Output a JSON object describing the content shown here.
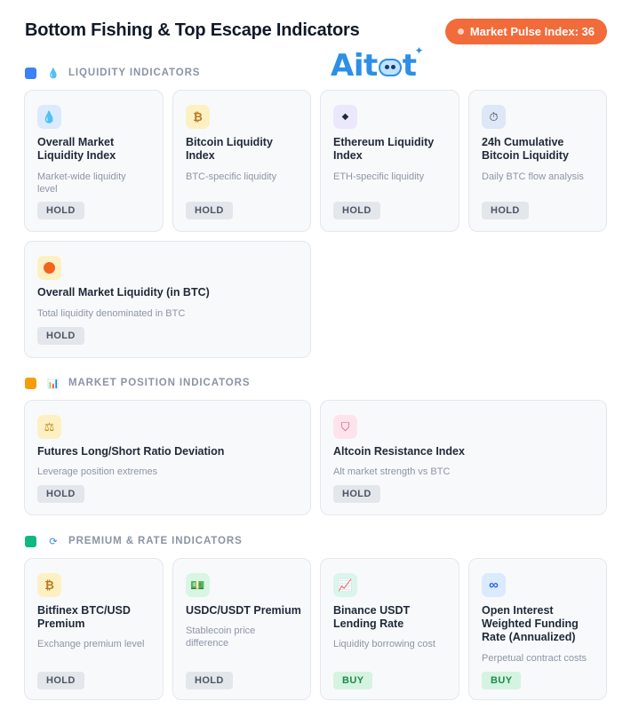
{
  "header": {
    "title": "Bottom Fishing & Top Escape Indicators",
    "pulse_label": "Market Pulse Index: 36"
  },
  "logo": {
    "text_left": "Ait",
    "text_right": "t"
  },
  "colors": {
    "accent_orange": "#f26b3a",
    "liquidity": "#3b82f6",
    "position": "#f59e0b",
    "premium": "#10b981",
    "hold_bg": "#e3e6eb",
    "buy_bg": "#d5f3e1"
  },
  "sections": [
    {
      "label": "LIQUIDITY INDICATORS",
      "icon": "droplet-icon",
      "cards": [
        {
          "title_1": "Overall Market",
          "title_2": "Liquidity Index",
          "desc_1": "Market-wide liquidity",
          "desc_2": "level",
          "signal": "HOLD",
          "icon": "droplet-icon"
        },
        {
          "title_1": "Bitcoin Liquidity",
          "title_2": "Index",
          "desc_1": "BTC-specific liquidity",
          "desc_2": "",
          "signal": "HOLD",
          "icon": "bitcoin-icon"
        },
        {
          "title_1": "Ethereum Liquidity",
          "title_2": "Index",
          "desc_1": "ETH-specific liquidity",
          "desc_2": "",
          "signal": "HOLD",
          "icon": "ethereum-icon"
        },
        {
          "title_1": "24h Cumulative",
          "title_2": "Bitcoin Liquidity",
          "desc_1": "Daily BTC flow analysis",
          "desc_2": "",
          "signal": "HOLD",
          "icon": "stopwatch-icon"
        },
        {
          "title_1": "Overall Market Liquidity (in BTC)",
          "title_2": "",
          "desc_1": "Total liquidity denominated in BTC",
          "desc_2": "",
          "signal": "HOLD",
          "icon": "orange-circle-icon"
        }
      ]
    },
    {
      "label": "MARKET POSITION INDICATORS",
      "icon": "bar-chart-icon",
      "cards": [
        {
          "title_1": "Futures Long/Short Ratio Deviation",
          "title_2": "",
          "desc_1": "Leverage position extremes",
          "desc_2": "",
          "signal": "HOLD",
          "icon": "balance-scale-icon"
        },
        {
          "title_1": "Altcoin Resistance Index",
          "title_2": "",
          "desc_1": "Alt market strength vs BTC",
          "desc_2": "",
          "signal": "HOLD",
          "icon": "shield-icon"
        }
      ]
    },
    {
      "label": "PREMIUM & RATE INDICATORS",
      "icon": "cycle-icon",
      "cards": [
        {
          "title_1": "Bitfinex BTC/USD",
          "title_2": "Premium",
          "title_3": "",
          "desc_1": "Exchange premium level",
          "desc_2": "",
          "signal": "HOLD",
          "icon": "bitcoin-icon"
        },
        {
          "title_1": "USDC/USDT Premium",
          "title_2": "",
          "title_3": "",
          "desc_1": "Stablecoin price",
          "desc_2": "difference",
          "signal": "HOLD",
          "icon": "money-icon"
        },
        {
          "title_1": "Binance USDT",
          "title_2": "Lending Rate",
          "title_3": "",
          "desc_1": "Liquidity borrowing cost",
          "desc_2": "",
          "signal": "BUY",
          "icon": "trend-chart-icon"
        },
        {
          "title_1": "Open Interest",
          "title_2": "Weighted Funding",
          "title_3": "Rate (Annualized)",
          "desc_1": "Perpetual contract costs",
          "desc_2": "",
          "signal": "BUY",
          "icon": "infinity-icon"
        }
      ]
    }
  ]
}
